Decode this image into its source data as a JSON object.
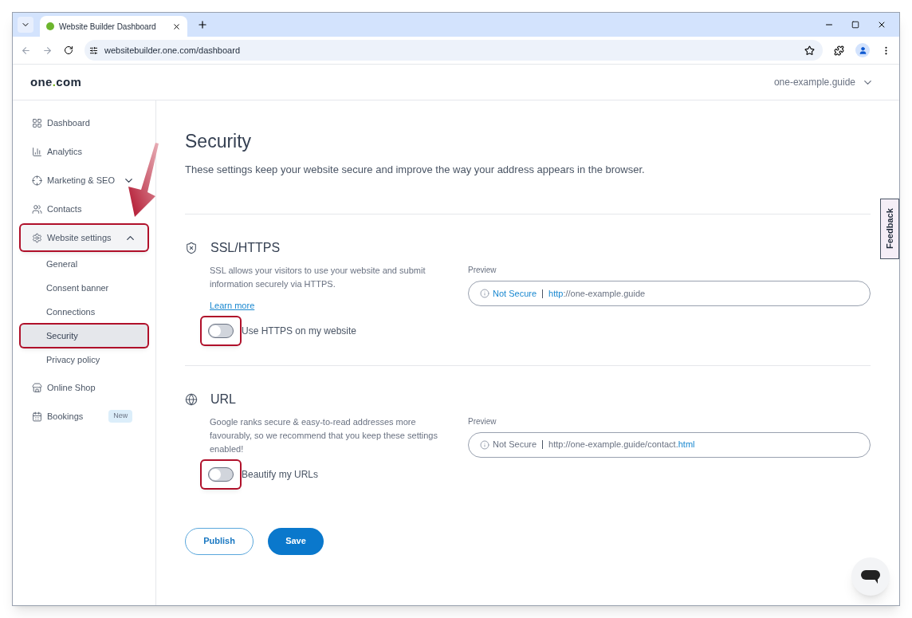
{
  "browser": {
    "tab_title": "Website Builder Dashboard",
    "address": "websitebuilder.one.com/dashboard"
  },
  "header": {
    "logo": {
      "before": "one",
      "dot": ".",
      "after": "com"
    },
    "site_selector": "one-example.guide"
  },
  "sidebar": {
    "items": [
      {
        "label": "Dashboard",
        "selected": false,
        "annotated": false
      },
      {
        "label": "Analytics",
        "selected": false,
        "annotated": false
      },
      {
        "label": "Marketing & SEO",
        "selected": false,
        "annotated": false,
        "expanded": false
      },
      {
        "label": "Contacts",
        "selected": false,
        "annotated": false
      },
      {
        "label": "Website settings",
        "selected": false,
        "annotated": true,
        "expanded": true,
        "children": [
          {
            "label": "General",
            "selected": false,
            "annotated": false
          },
          {
            "label": "Consent banner",
            "selected": false,
            "annotated": false
          },
          {
            "label": "Connections",
            "selected": false,
            "annotated": false
          },
          {
            "label": "Security",
            "selected": true,
            "annotated": true
          },
          {
            "label": "Privacy policy",
            "selected": false,
            "annotated": false
          }
        ]
      },
      {
        "label": "Online Shop",
        "selected": false,
        "annotated": false
      },
      {
        "label": "Bookings",
        "selected": false,
        "annotated": false,
        "badge": "New"
      }
    ]
  },
  "page": {
    "title": "Security",
    "subtitle": "These settings keep your website secure and improve the way your address appears in the browser."
  },
  "sections": [
    {
      "title": "SSL/HTTPS",
      "description": "SSL allows your visitors to use your website and submit information securely via HTTPS.",
      "link": "Learn more",
      "toggle": {
        "label": "Use HTTPS on my website",
        "on": false,
        "annotated": true
      },
      "preview": {
        "label": "Preview",
        "status": "Not Secure",
        "status_accent": true,
        "url_parts": [
          {
            "text": "http",
            "accent": true
          },
          {
            "text": "://one-example.guide",
            "accent": false
          }
        ]
      }
    },
    {
      "title": "URL",
      "description": "Google ranks secure & easy-to-read addresses more favourably, so we recommend that you keep these settings enabled!",
      "toggle": {
        "label": "Beautify my URLs",
        "on": false,
        "annotated": true
      },
      "preview": {
        "label": "Preview",
        "status": "Not Secure",
        "status_accent": false,
        "url_parts": [
          {
            "text": "http://one-example.guide/contact.",
            "accent": false
          },
          {
            "text": "html",
            "accent": true
          }
        ]
      }
    }
  ],
  "actions": {
    "secondary": "Publish",
    "primary": "Save"
  },
  "feedback": "Feedback"
}
